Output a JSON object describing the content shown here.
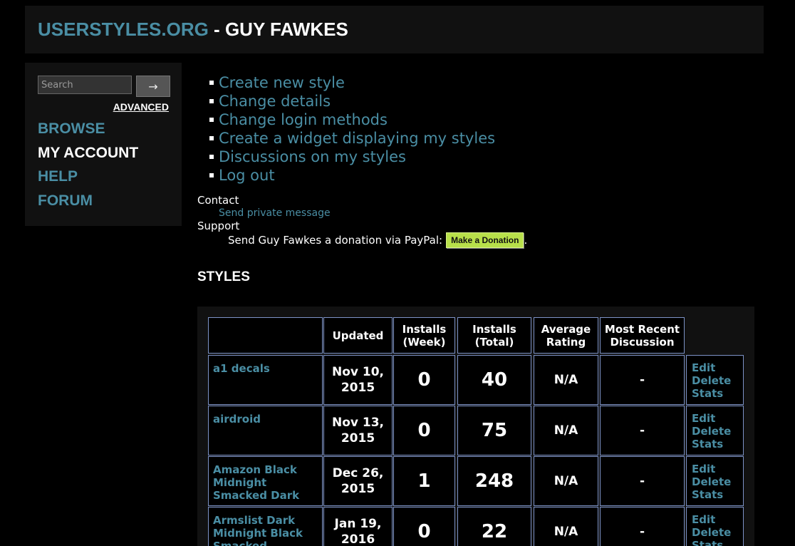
{
  "header": {
    "site": "USERSTYLES.ORG",
    "separator": " - ",
    "user": "GUY FAWKES"
  },
  "sidebar": {
    "search_placeholder": "Search",
    "search_button": "→",
    "advanced": "ADVANCED",
    "nav": [
      {
        "label": "BROWSE",
        "active": false
      },
      {
        "label": "MY ACCOUNT",
        "active": true
      },
      {
        "label": "HELP",
        "active": false
      },
      {
        "label": "FORUM",
        "active": false
      }
    ]
  },
  "menu": [
    "Create new style",
    "Change details",
    "Change login methods",
    "Create a widget displaying my styles",
    "Discussions on my styles",
    "Log out"
  ],
  "contact": {
    "label": "Contact",
    "pm": "Send private message"
  },
  "support": {
    "label": "Support",
    "text": "Send Guy Fawkes a donation via PayPal:",
    "button": "Make a Donation",
    "suffix": "."
  },
  "styles": {
    "heading": "STYLES",
    "columns": [
      "",
      "Updated",
      "Installs\n(Week)",
      "Installs\n(Total)",
      "Average\nRating",
      "Most Recent\nDiscussion"
    ],
    "rows": [
      {
        "name": "a1 decals",
        "updated": "Nov 10,\n2015",
        "week": "0",
        "total": "40",
        "rating": "N/A",
        "discussion": "-"
      },
      {
        "name": "airdroid",
        "updated": "Nov 13,\n2015",
        "week": "0",
        "total": "75",
        "rating": "N/A",
        "discussion": "-"
      },
      {
        "name": "Amazon Black Midnight Smacked Dark",
        "updated": "Dec 26,\n2015",
        "week": "1",
        "total": "248",
        "rating": "N/A",
        "discussion": "-"
      },
      {
        "name": "Armslist Dark Midnight Black Smacked",
        "updated": "Jan 19,\n2016",
        "week": "0",
        "total": "22",
        "rating": "N/A",
        "discussion": "-"
      }
    ],
    "actions": [
      "Edit",
      "Delete",
      "Stats"
    ]
  },
  "colors": {
    "link": "#4a8ea4",
    "background": "#000000",
    "panel": "#111111",
    "cell_border": "#7d93c7",
    "donate": "#b8e04a"
  }
}
